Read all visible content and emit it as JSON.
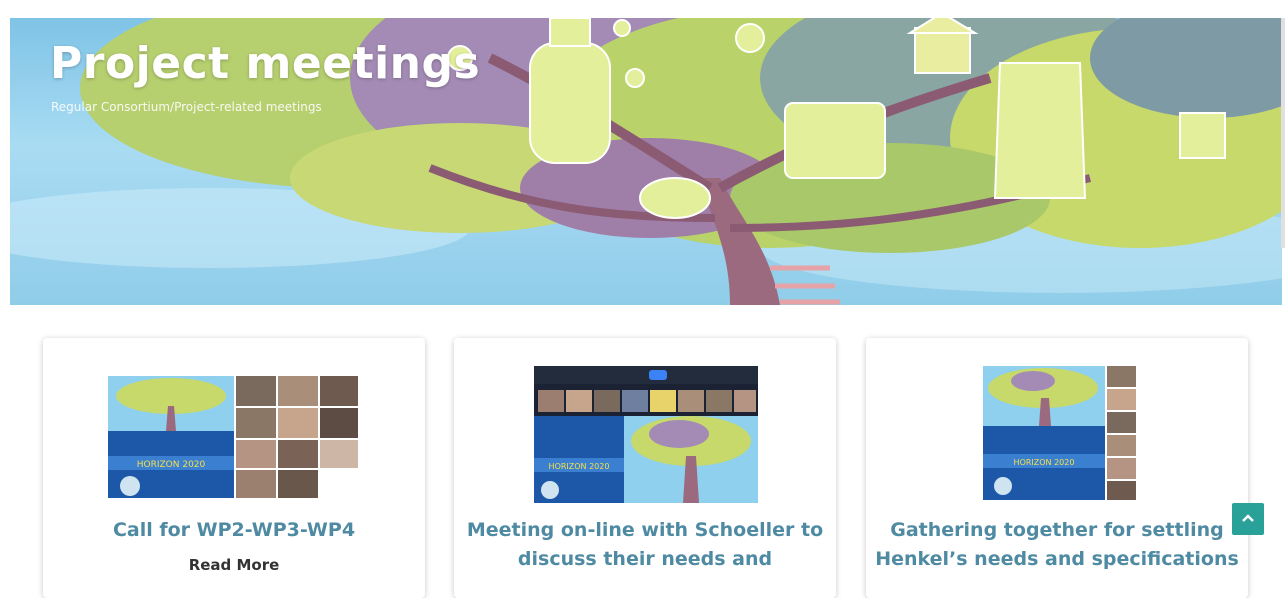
{
  "hero": {
    "title": "Project meetings",
    "subtitle": "Regular Consortium/Project-related meetings"
  },
  "cards": [
    {
      "title": "Call for WP2-WP3-WP4",
      "read_more": "Read More",
      "banner_text": "HORIZON 2020"
    },
    {
      "title_line1": "Meeting on-line with Schoeller to",
      "title_line2": "discuss their needs and",
      "banner_text": "HORIZON 2020"
    },
    {
      "title_line1": "Gathering together for settling",
      "title_line2": "Henkel’s needs and specifications",
      "banner_text": "HORIZON 2020"
    }
  ],
  "back_to_top": {
    "icon": "chevron-up-icon"
  },
  "colors": {
    "accent": "#2aa198",
    "card_title": "#4f8aa3"
  }
}
